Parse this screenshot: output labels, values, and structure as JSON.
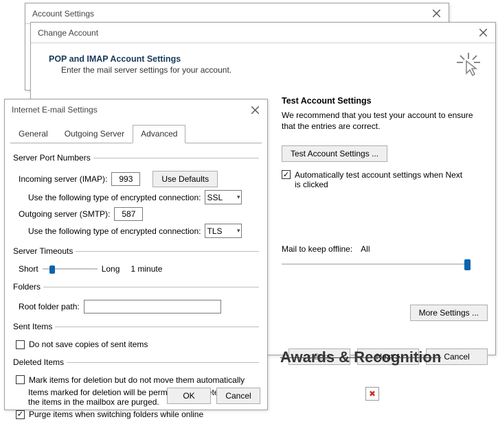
{
  "accountSettings": {
    "title": "Account Settings"
  },
  "changeAccount": {
    "title": "Change Account",
    "heading": "POP and IMAP Account Settings",
    "sub": "Enter the mail server settings for your account.",
    "testTitle": "Test Account Settings",
    "testText": "We recommend that you test your account to ensure that the entries are correct.",
    "testButton": "Test Account Settings ...",
    "autoTestLabel": "Automatically test account settings when Next is clicked",
    "autoTestChecked": true,
    "offlineLabel": "Mail to keep offline:",
    "offlineValue": "All",
    "moreSettings": "More Settings ...",
    "back": "< Back",
    "next": "Next >",
    "cancel": "Cancel"
  },
  "ie": {
    "title": "Internet E-mail Settings",
    "tabs": {
      "general": "General",
      "outgoing": "Outgoing Server",
      "advanced": "Advanced"
    },
    "spn": {
      "legend": "Server Port Numbers",
      "incomingLabel": "Incoming server (IMAP):",
      "incomingValue": "993",
      "useDefaults": "Use Defaults",
      "encTypeLabel": "Use the following type of encrypted connection:",
      "incomingEnc": "SSL",
      "outgoingLabel": "Outgoing server (SMTP):",
      "outgoingValue": "587",
      "outgoingEnc": "TLS"
    },
    "timeouts": {
      "legend": "Server Timeouts",
      "short": "Short",
      "long": "Long",
      "value": "1 minute"
    },
    "folders": {
      "legend": "Folders",
      "rootLabel": "Root folder path:",
      "rootValue": ""
    },
    "sent": {
      "legend": "Sent Items",
      "noSaveLabel": "Do not save copies of sent items",
      "noSaveChecked": false
    },
    "deleted": {
      "legend": "Deleted Items",
      "markLabel": "Mark items for deletion but do not move them automatically",
      "markChecked": false,
      "markHelp": "Items marked for deletion will be permanently deleted when the items in the mailbox are purged.",
      "purgeLabel": "Purge items when switching folders while online",
      "purgeChecked": true
    },
    "ok": "OK",
    "cancel": "Cancel"
  },
  "background": {
    "heading": "Awards & Recognition"
  }
}
